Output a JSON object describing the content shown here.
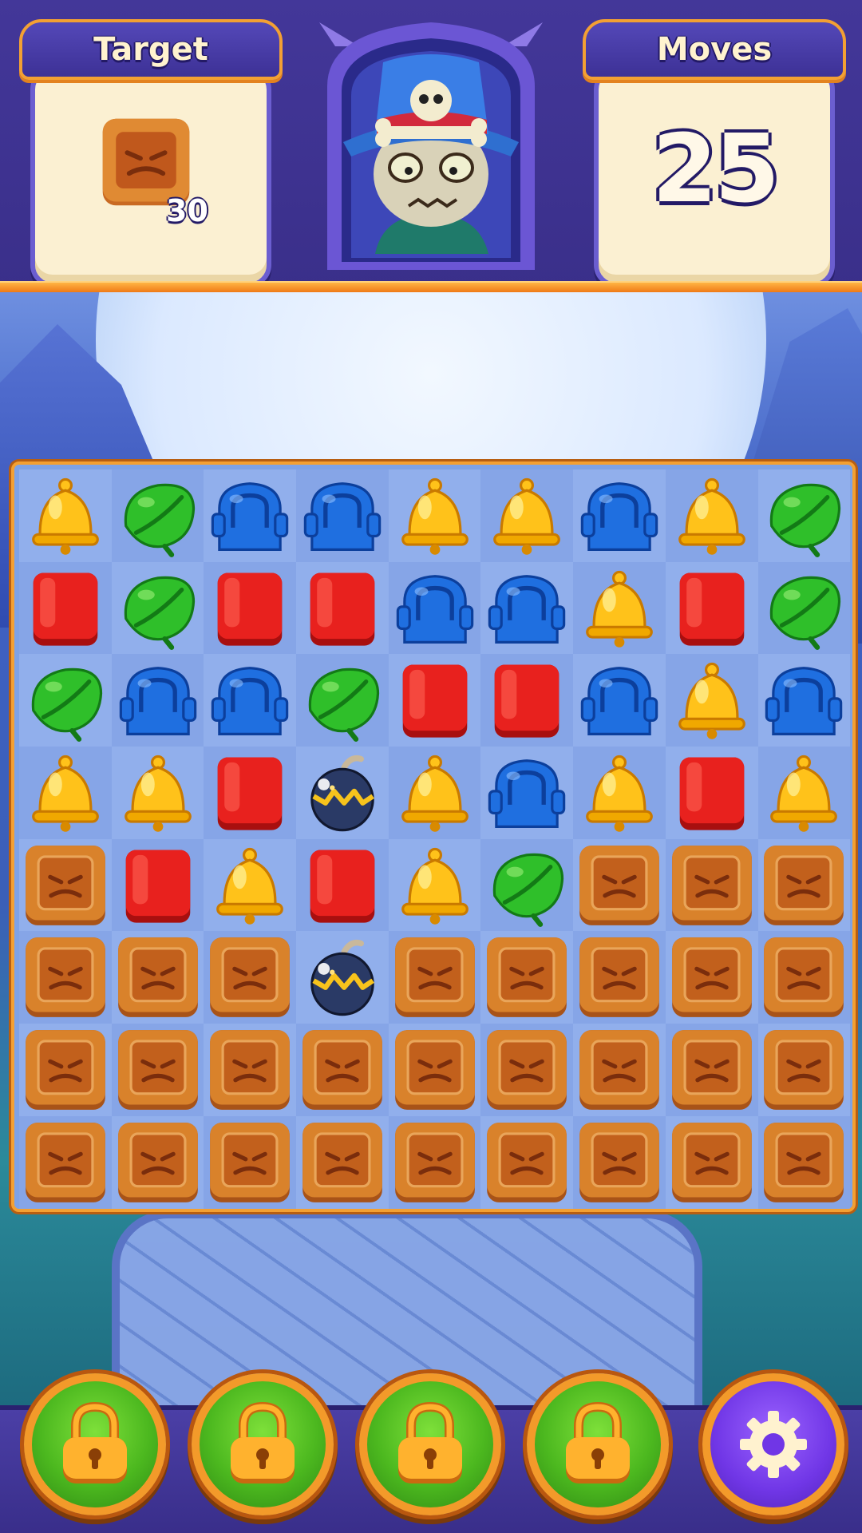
{
  "hud": {
    "target": {
      "title": "Target",
      "icon": "wooden-crate-icon",
      "count": "30"
    },
    "moves": {
      "title": "Moves",
      "value": "25"
    },
    "portrait": "skeleton-pirate-villain"
  },
  "board": {
    "columns": 9,
    "rows": 8,
    "tiles": [
      [
        "bell",
        "leaf",
        "tomb",
        "tomb",
        "bell",
        "bell",
        "tomb",
        "bell",
        "leaf"
      ],
      [
        "cube",
        "leaf",
        "cube",
        "cube",
        "tomb",
        "tomb",
        "bell",
        "cube",
        "leaf"
      ],
      [
        "leaf",
        "tomb",
        "tomb",
        "leaf",
        "cube",
        "cube",
        "tomb",
        "bell",
        "tomb"
      ],
      [
        "bell",
        "bell",
        "cube",
        "bomb",
        "bell",
        "tomb",
        "bell",
        "cube",
        "bell"
      ],
      [
        "crate",
        "cube",
        "bell",
        "cube",
        "bell",
        "leaf",
        "crate",
        "crate",
        "crate"
      ],
      [
        "crate",
        "crate",
        "crate",
        "bomb",
        "crate",
        "crate",
        "crate",
        "crate",
        "crate"
      ],
      [
        "crate",
        "crate",
        "crate",
        "crate",
        "crate",
        "crate",
        "crate",
        "crate",
        "crate"
      ],
      [
        "crate",
        "crate",
        "crate",
        "crate",
        "crate",
        "crate",
        "crate",
        "crate",
        "crate"
      ]
    ],
    "tile_colors": {
      "bell": "#ffc21a",
      "leaf": "#2fbf2a",
      "tomb": "#1f6fe0",
      "cube": "#e8211e",
      "crate": "#d9822b",
      "bomb": "#2a3a66"
    }
  },
  "boosters": [
    {
      "icon": "lock-icon",
      "locked": true
    },
    {
      "icon": "lock-icon",
      "locked": true
    },
    {
      "icon": "lock-icon",
      "locked": true
    },
    {
      "icon": "lock-icon",
      "locked": true
    }
  ],
  "settings": {
    "icon": "gear-icon"
  },
  "colors": {
    "hud_bg": "#433799",
    "accent_orange": "#f3a033",
    "panel_cream": "#fbf0d2",
    "booster_green": "#4cb81f",
    "settings_purple": "#7036e6"
  }
}
